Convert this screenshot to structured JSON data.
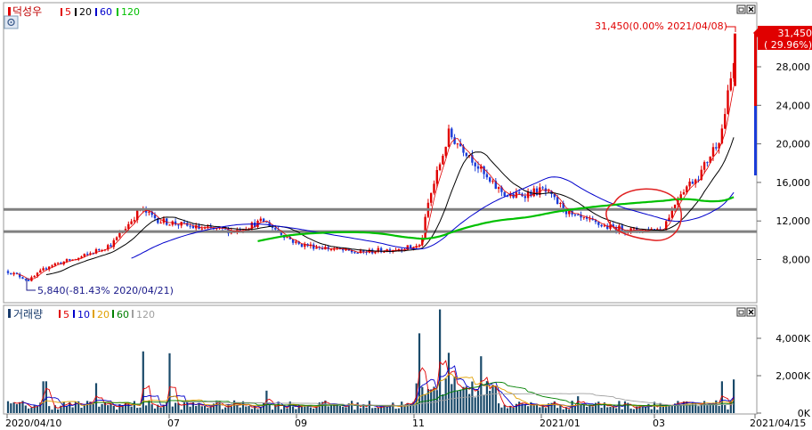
{
  "price_panel": {
    "stock_name": "덕성우",
    "legend": [
      {
        "label": "5",
        "color": "#e00000"
      },
      {
        "label": "20",
        "color": "#000000"
      },
      {
        "label": "60",
        "color": "#0000cc"
      },
      {
        "label": "120",
        "color": "#00c000"
      }
    ],
    "gear_icon": "gear-icon",
    "high_annotation": "31,450(0.00% 2021/04/08)",
    "low_annotation": "5,840(-81.43% 2020/04/21)",
    "current_price": "31,450",
    "current_change": "( 29.96%)",
    "y_ticks": [
      "28,000",
      "24,000",
      "20,000",
      "16,000",
      "12,000",
      "8,000"
    ],
    "window_icons": [
      "restore-icon",
      "close-icon"
    ]
  },
  "volume_panel": {
    "title": "거래량",
    "legend": [
      {
        "label": "5",
        "color": "#e00000"
      },
      {
        "label": "10",
        "color": "#0000cc"
      },
      {
        "label": "20",
        "color": "#e0a000"
      },
      {
        "label": "60",
        "color": "#008000"
      },
      {
        "label": "120",
        "color": "#a0a0a0"
      }
    ],
    "y_ticks": [
      "4,000K",
      "2,000K",
      "0K"
    ],
    "window_icons": [
      "restore-icon",
      "close-icon"
    ]
  },
  "x_axis": {
    "labels": [
      "2020/04/10",
      "07",
      "09",
      "11",
      "2021/01",
      "03",
      "2021/04/15"
    ]
  },
  "chart_data": [
    {
      "type": "candlestick",
      "title": "덕성우",
      "y_unit": "KRW",
      "ylim": [
        5000,
        33000
      ],
      "y_ticks": [
        8000,
        12000,
        16000,
        20000,
        24000,
        28000
      ],
      "x_range": [
        "2020/04/10",
        "2021/04/15"
      ],
      "support_lines": [
        10900,
        13200
      ],
      "series": [
        {
          "name": "5",
          "color": "#e00000"
        },
        {
          "name": "20",
          "color": "#000000"
        },
        {
          "name": "60",
          "color": "#0000cc"
        },
        {
          "name": "120",
          "color": "#00c000"
        }
      ],
      "x": [
        "2020/04/10",
        "2020/04/21",
        "2020/05/01",
        "2020/05/15",
        "2020/06/01",
        "2020/06/15",
        "2020/06/25",
        "2020/07/01",
        "2020/07/15",
        "2020/08/01",
        "2020/08/15",
        "2020/09/01",
        "2020/09/15",
        "2020/10/01",
        "2020/10/15",
        "2020/11/01",
        "2020/11/05",
        "2020/11/15",
        "2020/11/25",
        "2020/12/05",
        "2020/12/15",
        "2021/01/01",
        "2021/01/15",
        "2021/02/01",
        "2021/02/15",
        "2021/03/01",
        "2021/03/10",
        "2021/03/20",
        "2021/03/30",
        "2021/04/08"
      ],
      "close": [
        6800,
        5840,
        7400,
        8100,
        9600,
        13200,
        12000,
        11800,
        11200,
        11000,
        12000,
        9600,
        9200,
        8700,
        9000,
        9400,
        14000,
        21000,
        19000,
        16000,
        14500,
        15200,
        12500,
        11400,
        11000,
        11200,
        15000,
        17000,
        21000,
        31450
      ],
      "annotations": [
        {
          "text": "31,450(0.00% 2021/04/08)",
          "x": "2021/04/08",
          "y": 31450
        },
        {
          "text": "5,840(-81.43% 2020/04/21)",
          "x": "2020/04/21",
          "y": 5840
        }
      ]
    },
    {
      "type": "bar",
      "title": "거래량",
      "y_unit": "K",
      "ylim": [
        0,
        5000
      ],
      "y_ticks": [
        0,
        2000,
        4000
      ],
      "series": [
        {
          "name": "5",
          "color": "#e00000"
        },
        {
          "name": "10",
          "color": "#0000cc"
        },
        {
          "name": "20",
          "color": "#e0a000"
        },
        {
          "name": "60",
          "color": "#008000"
        },
        {
          "name": "120",
          "color": "#a0a0a0"
        }
      ]
    }
  ]
}
